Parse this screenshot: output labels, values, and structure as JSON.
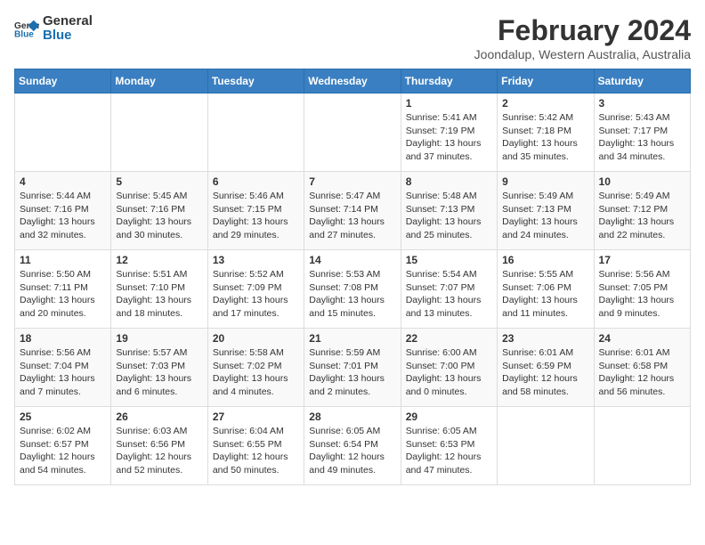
{
  "header": {
    "logo_general": "General",
    "logo_blue": "Blue",
    "main_title": "February 2024",
    "subtitle": "Joondalup, Western Australia, Australia"
  },
  "calendar": {
    "days_of_week": [
      "Sunday",
      "Monday",
      "Tuesday",
      "Wednesday",
      "Thursday",
      "Friday",
      "Saturday"
    ],
    "weeks": [
      [
        {
          "day": "",
          "info": ""
        },
        {
          "day": "",
          "info": ""
        },
        {
          "day": "",
          "info": ""
        },
        {
          "day": "",
          "info": ""
        },
        {
          "day": "1",
          "info": "Sunrise: 5:41 AM\nSunset: 7:19 PM\nDaylight: 13 hours\nand 37 minutes."
        },
        {
          "day": "2",
          "info": "Sunrise: 5:42 AM\nSunset: 7:18 PM\nDaylight: 13 hours\nand 35 minutes."
        },
        {
          "day": "3",
          "info": "Sunrise: 5:43 AM\nSunset: 7:17 PM\nDaylight: 13 hours\nand 34 minutes."
        }
      ],
      [
        {
          "day": "4",
          "info": "Sunrise: 5:44 AM\nSunset: 7:16 PM\nDaylight: 13 hours\nand 32 minutes."
        },
        {
          "day": "5",
          "info": "Sunrise: 5:45 AM\nSunset: 7:16 PM\nDaylight: 13 hours\nand 30 minutes."
        },
        {
          "day": "6",
          "info": "Sunrise: 5:46 AM\nSunset: 7:15 PM\nDaylight: 13 hours\nand 29 minutes."
        },
        {
          "day": "7",
          "info": "Sunrise: 5:47 AM\nSunset: 7:14 PM\nDaylight: 13 hours\nand 27 minutes."
        },
        {
          "day": "8",
          "info": "Sunrise: 5:48 AM\nSunset: 7:13 PM\nDaylight: 13 hours\nand 25 minutes."
        },
        {
          "day": "9",
          "info": "Sunrise: 5:49 AM\nSunset: 7:13 PM\nDaylight: 13 hours\nand 24 minutes."
        },
        {
          "day": "10",
          "info": "Sunrise: 5:49 AM\nSunset: 7:12 PM\nDaylight: 13 hours\nand 22 minutes."
        }
      ],
      [
        {
          "day": "11",
          "info": "Sunrise: 5:50 AM\nSunset: 7:11 PM\nDaylight: 13 hours\nand 20 minutes."
        },
        {
          "day": "12",
          "info": "Sunrise: 5:51 AM\nSunset: 7:10 PM\nDaylight: 13 hours\nand 18 minutes."
        },
        {
          "day": "13",
          "info": "Sunrise: 5:52 AM\nSunset: 7:09 PM\nDaylight: 13 hours\nand 17 minutes."
        },
        {
          "day": "14",
          "info": "Sunrise: 5:53 AM\nSunset: 7:08 PM\nDaylight: 13 hours\nand 15 minutes."
        },
        {
          "day": "15",
          "info": "Sunrise: 5:54 AM\nSunset: 7:07 PM\nDaylight: 13 hours\nand 13 minutes."
        },
        {
          "day": "16",
          "info": "Sunrise: 5:55 AM\nSunset: 7:06 PM\nDaylight: 13 hours\nand 11 minutes."
        },
        {
          "day": "17",
          "info": "Sunrise: 5:56 AM\nSunset: 7:05 PM\nDaylight: 13 hours\nand 9 minutes."
        }
      ],
      [
        {
          "day": "18",
          "info": "Sunrise: 5:56 AM\nSunset: 7:04 PM\nDaylight: 13 hours\nand 7 minutes."
        },
        {
          "day": "19",
          "info": "Sunrise: 5:57 AM\nSunset: 7:03 PM\nDaylight: 13 hours\nand 6 minutes."
        },
        {
          "day": "20",
          "info": "Sunrise: 5:58 AM\nSunset: 7:02 PM\nDaylight: 13 hours\nand 4 minutes."
        },
        {
          "day": "21",
          "info": "Sunrise: 5:59 AM\nSunset: 7:01 PM\nDaylight: 13 hours\nand 2 minutes."
        },
        {
          "day": "22",
          "info": "Sunrise: 6:00 AM\nSunset: 7:00 PM\nDaylight: 13 hours\nand 0 minutes."
        },
        {
          "day": "23",
          "info": "Sunrise: 6:01 AM\nSunset: 6:59 PM\nDaylight: 12 hours\nand 58 minutes."
        },
        {
          "day": "24",
          "info": "Sunrise: 6:01 AM\nSunset: 6:58 PM\nDaylight: 12 hours\nand 56 minutes."
        }
      ],
      [
        {
          "day": "25",
          "info": "Sunrise: 6:02 AM\nSunset: 6:57 PM\nDaylight: 12 hours\nand 54 minutes."
        },
        {
          "day": "26",
          "info": "Sunrise: 6:03 AM\nSunset: 6:56 PM\nDaylight: 12 hours\nand 52 minutes."
        },
        {
          "day": "27",
          "info": "Sunrise: 6:04 AM\nSunset: 6:55 PM\nDaylight: 12 hours\nand 50 minutes."
        },
        {
          "day": "28",
          "info": "Sunrise: 6:05 AM\nSunset: 6:54 PM\nDaylight: 12 hours\nand 49 minutes."
        },
        {
          "day": "29",
          "info": "Sunrise: 6:05 AM\nSunset: 6:53 PM\nDaylight: 12 hours\nand 47 minutes."
        },
        {
          "day": "",
          "info": ""
        },
        {
          "day": "",
          "info": ""
        }
      ]
    ]
  }
}
